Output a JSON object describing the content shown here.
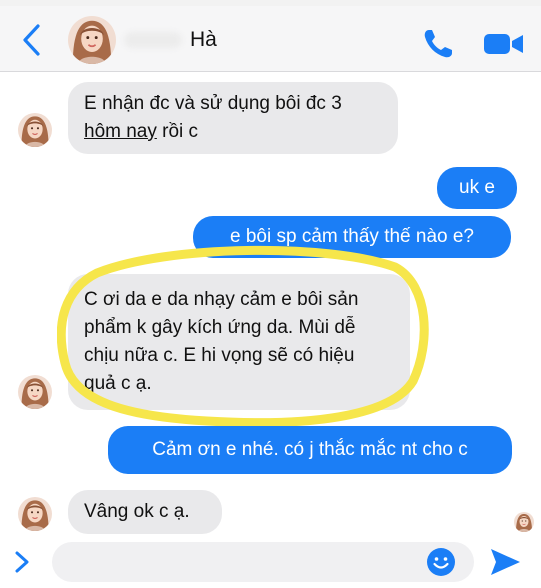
{
  "header": {
    "contact_name": "Hà",
    "icons": [
      "back-chevron-icon",
      "phone-icon",
      "video-camera-icon"
    ]
  },
  "messages": [
    {
      "direction": "incoming",
      "line1": "E nhận đc và sử dụng bôi đc 3",
      "line2_underlined": "hôm nay",
      "line2_rest": " rồi c"
    },
    {
      "direction": "outgoing",
      "text": "uk e"
    },
    {
      "direction": "outgoing",
      "text": "e bôi sp cảm thấy thế nào e?"
    },
    {
      "direction": "incoming",
      "lines": [
        "C ơi da e da nhạy cảm e bôi sản",
        "phẩm k gây kích ứng da. Mùi dễ",
        "chịu nữa c. E hi vọng sẽ có hiệu",
        "quả c ạ."
      ],
      "highlighted": true
    },
    {
      "direction": "outgoing",
      "text": "Cảm ơn e nhé. có j thắc mắc nt cho c"
    },
    {
      "direction": "incoming",
      "text": "Vâng ok c ạ."
    }
  ],
  "composer": {
    "value": "",
    "icons": [
      "chevron-right-icon",
      "emoji-icon",
      "send-icon"
    ]
  },
  "colors": {
    "accent_blue": "#1b7ef6",
    "incoming_bubble": "#e9e9eb",
    "highlight_yellow": "#f6e64b"
  }
}
